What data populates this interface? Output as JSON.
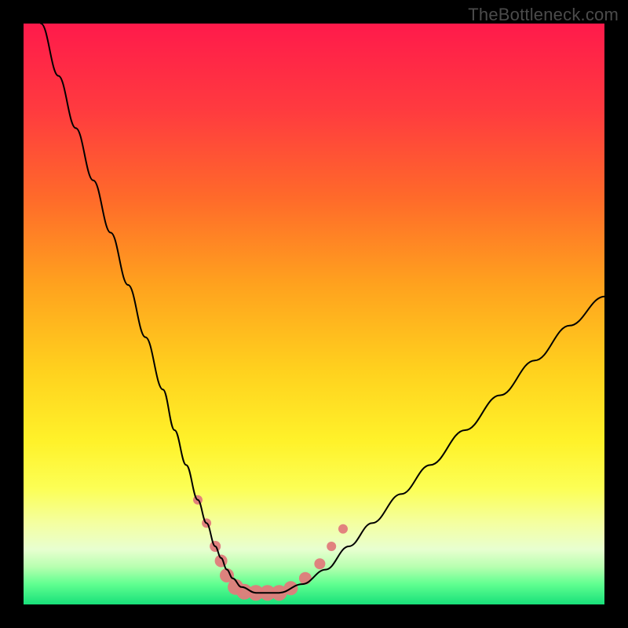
{
  "watermark": "TheBottleneck.com",
  "chart_data": {
    "type": "line",
    "title": "",
    "xlabel": "",
    "ylabel": "",
    "xlim": [
      0,
      100
    ],
    "ylim": [
      0,
      100
    ],
    "grid": false,
    "legend": false,
    "gradient_stops": [
      {
        "offset": 0.0,
        "color": "#ff1a4b"
      },
      {
        "offset": 0.15,
        "color": "#ff3b3f"
      },
      {
        "offset": 0.3,
        "color": "#ff6a2a"
      },
      {
        "offset": 0.45,
        "color": "#ffa21e"
      },
      {
        "offset": 0.6,
        "color": "#ffd21e"
      },
      {
        "offset": 0.72,
        "color": "#fff22a"
      },
      {
        "offset": 0.8,
        "color": "#fcff55"
      },
      {
        "offset": 0.86,
        "color": "#f4ffa0"
      },
      {
        "offset": 0.905,
        "color": "#e8ffd0"
      },
      {
        "offset": 0.935,
        "color": "#b8ffb0"
      },
      {
        "offset": 0.965,
        "color": "#60ff90"
      },
      {
        "offset": 1.0,
        "color": "#18e07a"
      }
    ],
    "series": [
      {
        "name": "bottleneck-curve",
        "color": "#000000",
        "width": 2.0,
        "x": [
          3,
          6,
          9,
          12,
          15,
          18,
          21,
          24,
          26,
          28,
          30,
          31.5,
          33,
          34,
          35,
          36,
          37.5,
          40,
          44,
          48,
          52,
          56,
          60,
          65,
          70,
          76,
          82,
          88,
          94,
          100
        ],
        "y": [
          100,
          91,
          82,
          73,
          64,
          55,
          46,
          37,
          30,
          24,
          18,
          14,
          10,
          8,
          6,
          4.5,
          3,
          2,
          2,
          3.5,
          6,
          10,
          14,
          19,
          24,
          30,
          36,
          42,
          48,
          53
        ]
      }
    ],
    "markers": {
      "name": "highlight-band",
      "color": "#e07b7b",
      "alpha": 0.95,
      "points": [
        {
          "x": 30.0,
          "y": 18.0,
          "r": 6
        },
        {
          "x": 31.5,
          "y": 14.0,
          "r": 6
        },
        {
          "x": 33.0,
          "y": 10.0,
          "r": 7
        },
        {
          "x": 34.0,
          "y": 7.5,
          "r": 8
        },
        {
          "x": 35.0,
          "y": 5.0,
          "r": 9
        },
        {
          "x": 36.5,
          "y": 3.0,
          "r": 10
        },
        {
          "x": 38.0,
          "y": 2.2,
          "r": 10
        },
        {
          "x": 40.0,
          "y": 2.0,
          "r": 10
        },
        {
          "x": 42.0,
          "y": 2.0,
          "r": 10
        },
        {
          "x": 44.0,
          "y": 2.0,
          "r": 10
        },
        {
          "x": 46.0,
          "y": 2.8,
          "r": 9
        },
        {
          "x": 48.5,
          "y": 4.5,
          "r": 8
        },
        {
          "x": 51.0,
          "y": 7.0,
          "r": 7
        },
        {
          "x": 53.0,
          "y": 10.0,
          "r": 6
        },
        {
          "x": 55.0,
          "y": 13.0,
          "r": 6
        }
      ]
    }
  }
}
